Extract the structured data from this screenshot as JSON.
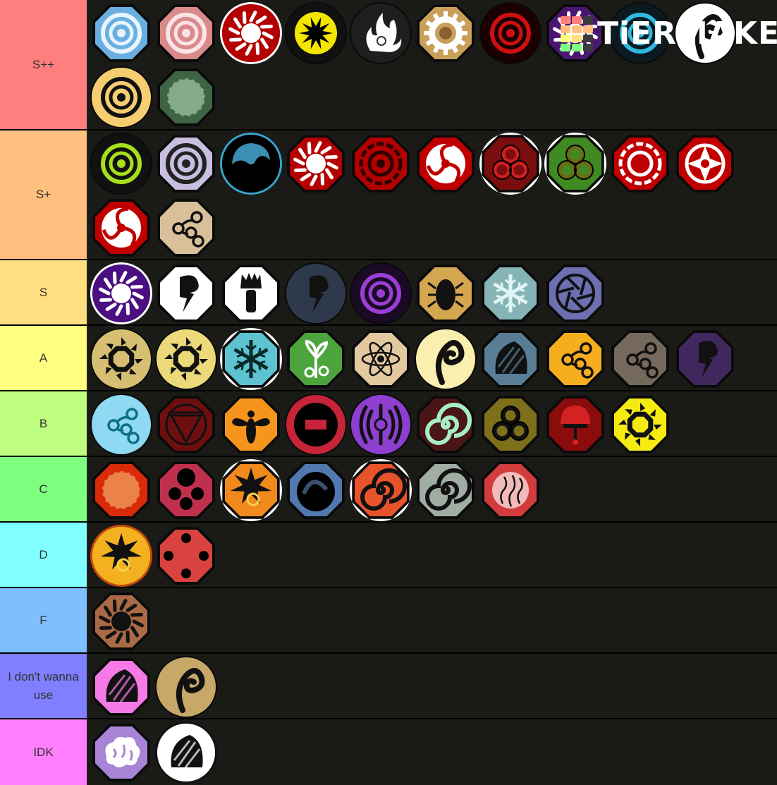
{
  "app": "TierMaker",
  "watermark": {
    "text": "TiERMAKER",
    "logo_grid_colors": [
      "#ff7f7f",
      "#ff7f7f",
      "#3a3a3a",
      "#ffbf7f",
      "#ffbf7f",
      "#ffbf7f",
      "#ffff7f",
      "#ffdf7f",
      "#3a3a3a",
      "#7fff7f",
      "#7fff7f",
      "#3a3a3a"
    ]
  },
  "tiers": [
    {
      "label": "S++",
      "color": "#ff7f7f",
      "items": [
        {
          "name": "spiral-blue",
          "shape": "oct",
          "bg": "#6aafe0",
          "fg": "#e8f4ff",
          "glyph": "rings"
        },
        {
          "name": "spiral-pink",
          "shape": "oct",
          "bg": "#d98a8a",
          "fg": "#fbe3e6",
          "glyph": "rings"
        },
        {
          "name": "sun-red",
          "shape": "circle",
          "bg": "#b30000",
          "fg": "#ffffff",
          "glyph": "sun",
          "ring": "#ffffff"
        },
        {
          "name": "star-yellow",
          "shape": "circle",
          "bg": "#111111",
          "fg": "#f5e600",
          "glyph": "star"
        },
        {
          "name": "white-flame",
          "shape": "circle",
          "bg": "#1e1e1e",
          "fg": "#ffffff",
          "glyph": "flame"
        },
        {
          "name": "gear-gold",
          "shape": "oct",
          "bg": "#c9a05a",
          "fg": "#ffffff",
          "glyph": "gear"
        },
        {
          "name": "red-vortex",
          "shape": "circle",
          "bg": "#1a0000",
          "fg": "#d01010",
          "glyph": "rings"
        },
        {
          "name": "purple-sun",
          "shape": "oct",
          "bg": "#4b1670",
          "fg": "#ffffff",
          "glyph": "sun"
        },
        {
          "name": "cyan-vortex",
          "shape": "circle",
          "bg": "#0a1a20",
          "fg": "#2fb8e0",
          "glyph": "rings"
        },
        {
          "name": "white-curl",
          "shape": "circle",
          "bg": "#ffffff",
          "fg": "#111111",
          "glyph": "curl"
        },
        {
          "name": "gold-spiral",
          "shape": "circle",
          "bg": "#f7cd72",
          "fg": "#111111",
          "glyph": "rings"
        },
        {
          "name": "green-dragon",
          "shape": "oct",
          "bg": "#3f6444",
          "fg": "#9cc3a0",
          "glyph": "blob"
        }
      ]
    },
    {
      "label": "S+",
      "color": "#ffbf7f",
      "items": [
        {
          "name": "lime-vortex",
          "shape": "circle",
          "bg": "#111111",
          "fg": "#a6e01c",
          "glyph": "rings"
        },
        {
          "name": "lavender-spiral",
          "shape": "oct",
          "bg": "#c8bedf",
          "fg": "#222222",
          "glyph": "rings"
        },
        {
          "name": "water-orb",
          "shape": "circle",
          "bg": "#000000",
          "fg": "#3a8fb3",
          "glyph": "wave",
          "ring": "#3aa3cc"
        },
        {
          "name": "red-sun",
          "shape": "oct",
          "bg": "#b30000",
          "fg": "#ffffff",
          "glyph": "sun"
        },
        {
          "name": "red-meander",
          "shape": "oct",
          "bg": "#b30000",
          "fg": "#2a0000",
          "glyph": "target"
        },
        {
          "name": "mangekyo-1",
          "shape": "oct",
          "bg": "#c00000",
          "fg": "#ffffff",
          "glyph": "tomoe"
        },
        {
          "name": "dark-red-triskele",
          "shape": "oct",
          "bg": "#7a0d0d",
          "fg": "#d21e1e",
          "glyph": "triskele",
          "ring": "#ffffff"
        },
        {
          "name": "green-triskele",
          "shape": "oct",
          "bg": "#3f8a23",
          "fg": "#6f6a15",
          "glyph": "triskele",
          "ring": "#ffffff"
        },
        {
          "name": "mangekyo-2",
          "shape": "oct",
          "bg": "#c00000",
          "fg": "#ffffff",
          "glyph": "target"
        },
        {
          "name": "mangekyo-3",
          "shape": "oct",
          "bg": "#c00000",
          "fg": "#ffffff",
          "glyph": "star6"
        },
        {
          "name": "mangekyo-4",
          "shape": "oct",
          "bg": "#c00000",
          "fg": "#ffffff",
          "glyph": "tomoe"
        },
        {
          "name": "sand-swirls",
          "shape": "oct",
          "bg": "#d8c09a",
          "fg": "#111111",
          "glyph": "clouds"
        }
      ]
    },
    {
      "label": "S",
      "color": "#ffdf7f",
      "items": [
        {
          "name": "purple-sun-ring",
          "shape": "circle",
          "bg": "#4a0f80",
          "fg": "#ffffff",
          "glyph": "sun",
          "ring": "#ffffff"
        },
        {
          "name": "storm-cloud",
          "shape": "oct",
          "bg": "#ffffff",
          "fg": "#111111",
          "glyph": "bolt"
        },
        {
          "name": "brush",
          "shape": "oct",
          "bg": "#ffffff",
          "fg": "#111111",
          "glyph": "brush"
        },
        {
          "name": "dark-lightning",
          "shape": "circle",
          "bg": "#2e3a4b",
          "fg": "#111111",
          "glyph": "bolt"
        },
        {
          "name": "purple-vortex",
          "shape": "circle",
          "bg": "#1a0a25",
          "fg": "#9b3ed6",
          "glyph": "rings"
        },
        {
          "name": "beetle",
          "shape": "oct",
          "bg": "#d4a650",
          "fg": "#111111",
          "glyph": "beetle"
        },
        {
          "name": "ice-crystal",
          "shape": "oct",
          "bg": "#86b4b6",
          "fg": "#dff4f4",
          "glyph": "snow"
        },
        {
          "name": "aperture",
          "shape": "oct",
          "bg": "#6c70b0",
          "fg": "#111111",
          "glyph": "aperture"
        }
      ]
    },
    {
      "label": "A",
      "color": "#ffff7f",
      "items": [
        {
          "name": "sand-hex",
          "shape": "circle",
          "bg": "#d6bf72",
          "fg": "#111111",
          "glyph": "hex"
        },
        {
          "name": "gold-hex",
          "shape": "circle",
          "bg": "#ecd97a",
          "fg": "#111111",
          "glyph": "hex"
        },
        {
          "name": "snowflake",
          "shape": "oct",
          "bg": "#5ec3d0",
          "fg": "#0a2a2a",
          "glyph": "snow",
          "ring": "#ffffff"
        },
        {
          "name": "sprout",
          "shape": "oct",
          "bg": "#4ea43c",
          "fg": "#ffffff",
          "glyph": "sprout"
        },
        {
          "name": "atom",
          "shape": "oct",
          "bg": "#e3c9a0",
          "fg": "#111111",
          "glyph": "atom"
        },
        {
          "name": "cream-spiral",
          "shape": "circle",
          "bg": "#fbefb0",
          "fg": "#111111",
          "glyph": "curl"
        },
        {
          "name": "steel-shell",
          "shape": "oct",
          "bg": "#5a7d96",
          "fg": "#111111",
          "glyph": "shell"
        },
        {
          "name": "orange-clouds",
          "shape": "oct",
          "bg": "#f6ad1e",
          "fg": "#111111",
          "glyph": "clouds"
        },
        {
          "name": "gray-clouds",
          "shape": "oct",
          "bg": "#75695b",
          "fg": "#111111",
          "glyph": "clouds"
        },
        {
          "name": "purple-storm",
          "shape": "oct",
          "bg": "#40285f",
          "fg": "#111111",
          "glyph": "bolt"
        }
      ]
    },
    {
      "label": "B",
      "color": "#bfff7f",
      "items": [
        {
          "name": "blue-swirls",
          "shape": "circle",
          "bg": "#8fd9f2",
          "fg": "#0e6f86",
          "glyph": "clouds"
        },
        {
          "name": "maroon-triangle",
          "shape": "oct",
          "bg": "#6e0f0f",
          "fg": "#111111",
          "glyph": "triangle"
        },
        {
          "name": "bee",
          "shape": "oct",
          "bg": "#f7941d",
          "fg": "#111111",
          "glyph": "bee"
        },
        {
          "name": "red-minus",
          "shape": "circle",
          "bg": "#c72339",
          "fg": "#000000",
          "glyph": "minus"
        },
        {
          "name": "purple-waves",
          "shape": "circle",
          "bg": "#8e3fd0",
          "fg": "#111111",
          "glyph": "sound"
        },
        {
          "name": "mint-swirl",
          "shape": "oct",
          "bg": "#4a1515",
          "fg": "#a7eec5",
          "glyph": "swirl"
        },
        {
          "name": "olive-triskele",
          "shape": "oct",
          "bg": "#7e6f1a",
          "fg": "#111111",
          "glyph": "triskele"
        },
        {
          "name": "red-mushroom",
          "shape": "oct",
          "bg": "#8a0c0c",
          "fg": "#d42121",
          "glyph": "mushroom"
        },
        {
          "name": "yellow-hex",
          "shape": "oct",
          "bg": "#f5ea12",
          "fg": "#111111",
          "glyph": "hex"
        }
      ]
    },
    {
      "label": "C",
      "color": "#7fff7f",
      "items": [
        {
          "name": "lava-rock",
          "shape": "oct",
          "bg": "#d92a0a",
          "fg": "#f0a060",
          "glyph": "blob"
        },
        {
          "name": "three-dots",
          "shape": "oct",
          "bg": "#c0304d",
          "fg": "#000000",
          "glyph": "dots3"
        },
        {
          "name": "orange-explosion",
          "shape": "oct",
          "bg": "#f08a1c",
          "fg": "#111111",
          "glyph": "burst",
          "ring": "#ffffff"
        },
        {
          "name": "blue-dome",
          "shape": "oct",
          "bg": "#5278b0",
          "fg": "#000000",
          "glyph": "dome"
        },
        {
          "name": "orange-swirl",
          "shape": "oct",
          "bg": "#e8532b",
          "fg": "#111111",
          "glyph": "swirl",
          "ring": "#ffffff"
        },
        {
          "name": "gray-swirl",
          "shape": "oct",
          "bg": "#a0ada4",
          "fg": "#111111",
          "glyph": "swirl"
        },
        {
          "name": "pink-steam",
          "shape": "oct",
          "bg": "#d23c3c",
          "fg": "#f6c8c8",
          "glyph": "steam"
        }
      ]
    },
    {
      "label": "D",
      "color": "#7fffff",
      "items": [
        {
          "name": "explosion-orb",
          "shape": "circle",
          "bg": "#f3b122",
          "fg": "#111111",
          "glyph": "burst",
          "ring": "#c24a0c"
        },
        {
          "name": "four-dots",
          "shape": "oct",
          "bg": "#d9433f",
          "fg": "#000000",
          "glyph": "dots4"
        }
      ]
    },
    {
      "label": "F",
      "color": "#7fbfff",
      "items": [
        {
          "name": "sand-burst",
          "shape": "oct",
          "bg": "#a96a45",
          "fg": "#111111",
          "glyph": "sun"
        }
      ]
    },
    {
      "label": "I don't wanna use",
      "color": "#7f7fff",
      "items": [
        {
          "name": "pink-crystal",
          "shape": "oct",
          "bg": "#f57ae6",
          "fg": "#111111",
          "glyph": "shell"
        },
        {
          "name": "gold-curl",
          "shape": "circle",
          "bg": "#c8a868",
          "fg": "#111111",
          "glyph": "curl"
        }
      ]
    },
    {
      "label": "IDK",
      "color": "#ff7fff",
      "items": [
        {
          "name": "brain",
          "shape": "oct",
          "bg": "#a784d6",
          "fg": "#ffffff",
          "glyph": "brain"
        },
        {
          "name": "white-shell",
          "shape": "circle",
          "bg": "#ffffff",
          "fg": "#111111",
          "glyph": "shell",
          "ring": "#111111"
        }
      ]
    }
  ]
}
